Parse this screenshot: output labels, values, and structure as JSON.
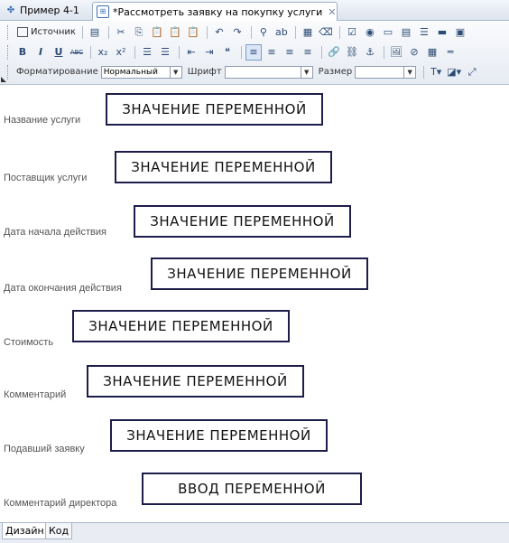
{
  "tabs": [
    {
      "label": "Пример 4-1",
      "icon": "example-icon"
    },
    {
      "label": "*Рассмотреть заявку на покупку услуги",
      "icon": "form-icon",
      "close": "✕"
    }
  ],
  "toolbar": {
    "source_label": "Источник",
    "formatting_label": "Форматирование",
    "format_value": "Нормальный",
    "font_label": "Шрифт",
    "font_value": "",
    "size_label": "Размер",
    "size_value": ""
  },
  "fields": [
    {
      "label": "Название услуги",
      "value": "ЗНАЧЕНИЕ ПЕРЕМЕННОЙ"
    },
    {
      "label": "Поставщик услуги",
      "value": "ЗНАЧЕНИЕ ПЕРЕМЕННОЙ"
    },
    {
      "label": "Дата начала действия",
      "value": "ЗНАЧЕНИЕ ПЕРЕМЕННОЙ"
    },
    {
      "label": "Дата окончания действия",
      "value": "ЗНАЧЕНИЕ ПЕРЕМЕННОЙ"
    },
    {
      "label": "Стоимость",
      "value": "ЗНАЧЕНИЕ ПЕРЕМЕННОЙ"
    },
    {
      "label": "Комментарий",
      "value": "ЗНАЧЕНИЕ ПЕРЕМЕННОЙ"
    },
    {
      "label": "Подавший заявку",
      "value": "ЗНАЧЕНИЕ ПЕРЕМЕННОЙ"
    },
    {
      "label": "Комментарий директора",
      "value": "ВВОД ПЕРЕМЕННОЙ"
    }
  ],
  "bottom_tabs": [
    {
      "label": "Дизайн",
      "active": true
    },
    {
      "label": "Код",
      "active": false
    }
  ]
}
